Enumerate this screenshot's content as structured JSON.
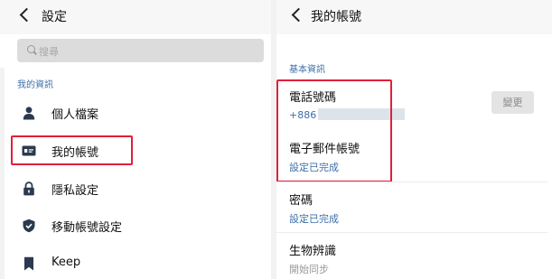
{
  "left": {
    "title": "設定",
    "search": {
      "placeholder": "搜尋"
    },
    "section": "我的資訊",
    "items": [
      {
        "label": "個人檔案",
        "icon": "person-icon"
      },
      {
        "label": "我的帳號",
        "icon": "id-card-icon",
        "highlighted": true
      },
      {
        "label": "隱私設定",
        "icon": "lock-icon"
      },
      {
        "label": "移動帳號設定",
        "icon": "shield-check-icon"
      },
      {
        "label": "Keep",
        "icon": "bookmark-icon"
      }
    ]
  },
  "right": {
    "title": "我的帳號",
    "section": "基本資訊",
    "phone": {
      "title": "電話號碼",
      "value": "+886"
    },
    "email": {
      "title": "電子郵件帳號",
      "status": "設定已完成"
    },
    "password": {
      "title": "密碼",
      "status": "設定已完成"
    },
    "biometric": {
      "title": "生物辨識",
      "status": "開始同步"
    },
    "change_button": "變更"
  },
  "colors": {
    "accent": "#3d6fa8",
    "highlight": "#e0203a",
    "icon": "#2b3a4e"
  }
}
